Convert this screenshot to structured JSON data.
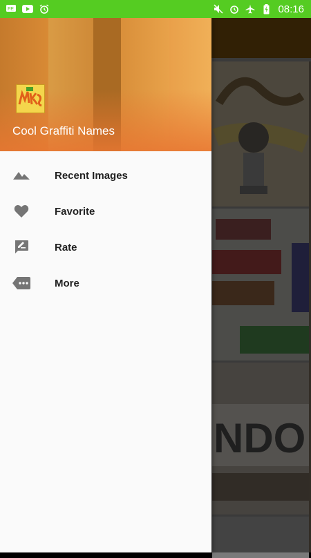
{
  "status_bar": {
    "time": "08:16",
    "left_icons": [
      "notification-icon",
      "youtube-icon",
      "alarm-icon"
    ],
    "right_icons": [
      "mute-icon",
      "alarm-icon",
      "airplane-icon",
      "battery-charging-icon"
    ],
    "color": "#55cc22"
  },
  "drawer": {
    "header": {
      "title": "Cool Graffiti Names"
    },
    "items": [
      {
        "label": "Recent Images",
        "icon": "landscape-icon"
      },
      {
        "label": "Favorite",
        "icon": "heart-icon"
      },
      {
        "label": "Rate",
        "icon": "rate-review-icon"
      },
      {
        "label": "More",
        "icon": "more-label-icon"
      }
    ]
  }
}
